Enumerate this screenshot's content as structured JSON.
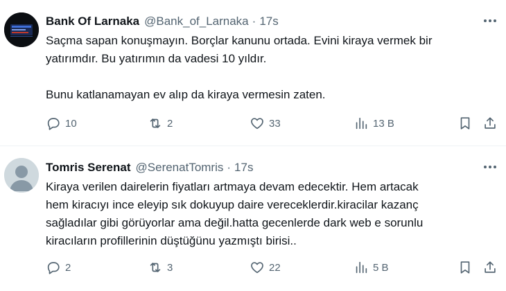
{
  "tweets": [
    {
      "display_name": "Bank Of Larnaka",
      "handle": "@Bank_of_Larnaka",
      "separator": "·",
      "time": "17s",
      "text": "Saçma sapan konuşmayın. Borçlar kanunu ortada. Evini kiraya vermek bir\nyatırımdır. Bu yatırımın da vadesi 10 yıldır.\n\nBunu katlanamayan ev alıp da kiraya vermesin zaten.",
      "replies": "10",
      "retweets": "2",
      "likes": "33",
      "views": "13 B",
      "avatar_icon": "bank-logo-icon"
    },
    {
      "display_name": "Tomris Serenat",
      "handle": "@SerenatTomris",
      "separator": "·",
      "time": "17s",
      "text": "Kiraya verilen dairelerin fiyatları artmaya devam edecektir. Hem artacak\nhem kiracıyı ince eleyip sık dokuyup daire vereceklerdir.kiracilar kazanç\nsağladılar gibi görüyorlar ama değil.hatta gecenlerde dark web e sorunlu\nkiracıların profillerinin düştüğünu yazmıştı birisi..",
      "replies": "2",
      "retweets": "3",
      "likes": "22",
      "views": "5 B",
      "avatar_icon": "default-avatar-icon"
    }
  ],
  "icons": {
    "more": "more-options-icon",
    "reply": "reply-icon",
    "retweet": "retweet-icon",
    "like": "heart-icon",
    "views": "views-chart-icon",
    "bookmark": "bookmark-icon",
    "share": "share-icon"
  },
  "colors": {
    "text_primary": "#0f1419",
    "text_secondary": "#536471",
    "divider": "#eff3f4",
    "default_avatar_bg": "#cfd9de"
  }
}
